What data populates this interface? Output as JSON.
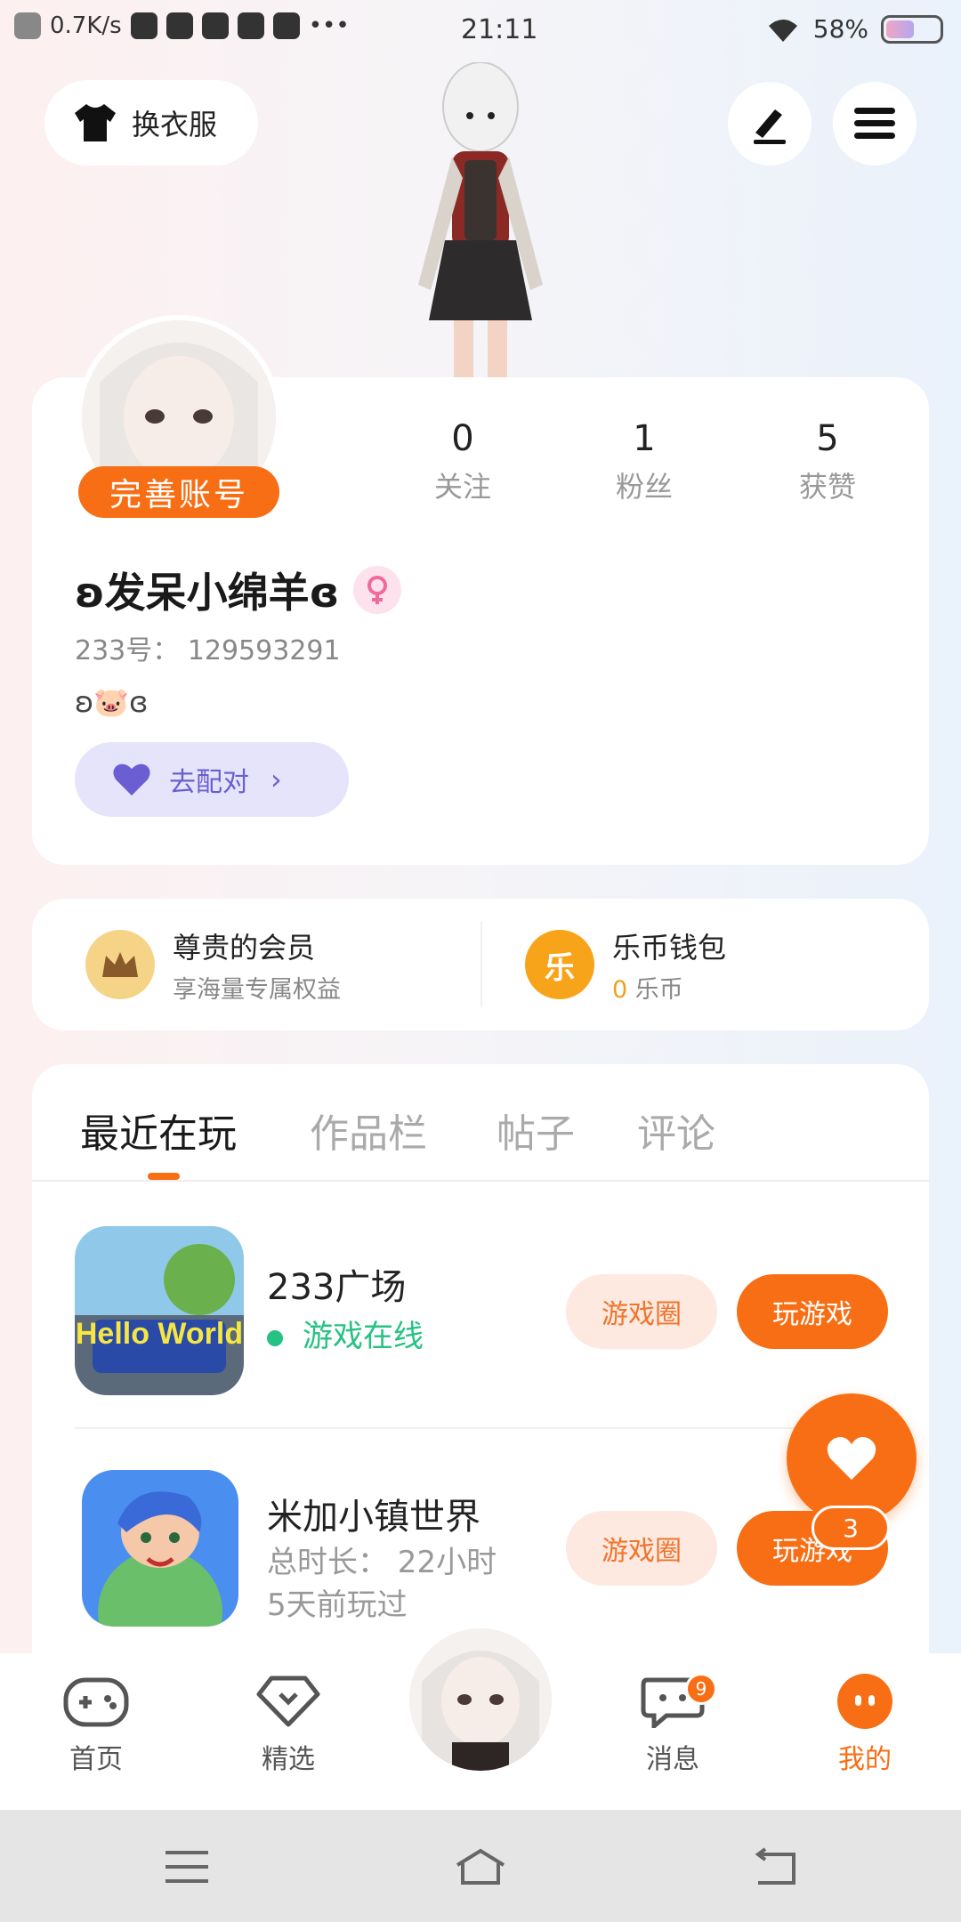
{
  "status_bar": {
    "speed": "0.7K/s",
    "time": "21:11",
    "battery": "58%",
    "battery_level": 0.58
  },
  "top": {
    "outfit_label": "换衣服"
  },
  "profile": {
    "complete_label": "完善账号",
    "stats": [
      {
        "num": "0",
        "label": "关注"
      },
      {
        "num": "1",
        "label": "粉丝"
      },
      {
        "num": "5",
        "label": "获赞"
      }
    ],
    "nickname": "ʚ发呆小绵羊ɞ",
    "uid": "233号： 129593291",
    "signature": "ʚ🐷ɞ",
    "pair_label": "去配对"
  },
  "vip": {
    "member_title": "尊贵的会员",
    "member_sub": "享海量专属权益",
    "wallet_icon": "乐",
    "wallet_title": "乐币钱包",
    "wallet_amount": "0",
    "wallet_unit": "乐币"
  },
  "tabs": [
    "最近在玩",
    "作品栏",
    "帖子",
    "评论"
  ],
  "games": [
    {
      "name": "233广场",
      "status": "游戏在线",
      "icon_text": "Hello World",
      "circle_label": "游戏圈",
      "play_label": "玩游戏"
    },
    {
      "name": "米加小镇世界",
      "playtime": "总时长： 22小时",
      "last_played": "5天前玩过",
      "circle_label": "游戏圈",
      "play_label": "玩游戏"
    }
  ],
  "floating": {
    "count": "3"
  },
  "bottom_nav": {
    "items": [
      {
        "label": "首页"
      },
      {
        "label": "精选"
      },
      {
        "label": "消息",
        "badge": "9"
      },
      {
        "label": "我的"
      }
    ]
  },
  "colors": {
    "accent": "#f86e14",
    "online": "#26c283",
    "pair": "#6a5ed2"
  }
}
